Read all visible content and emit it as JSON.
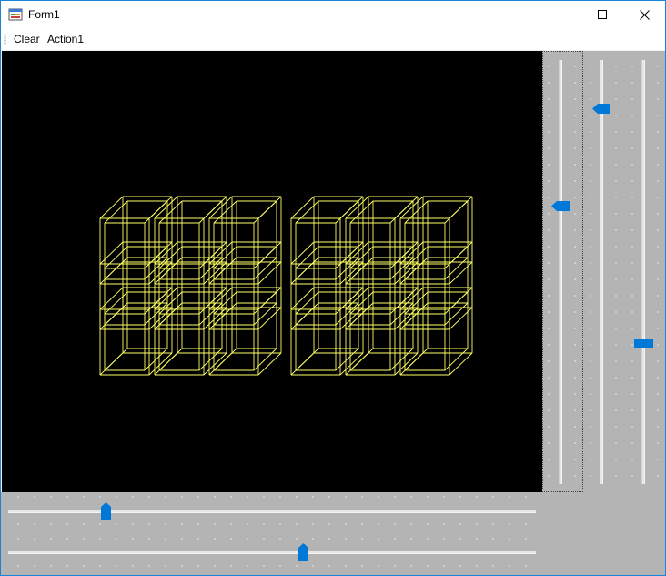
{
  "window": {
    "title": "Form1",
    "controls": [
      "minimize",
      "maximize",
      "close"
    ]
  },
  "menu": {
    "items": [
      {
        "label": "Clear"
      },
      {
        "label": "Action1"
      }
    ]
  },
  "viewport": {
    "background": "#000000",
    "wire_color": "#ffff66",
    "content": "two 3x3 grids of wireframe cubes"
  },
  "sliders": {
    "vertical_1": {
      "value": 0.34,
      "focused": true
    },
    "vertical_2": {
      "value": 0.11
    },
    "vertical_3": {
      "value": 0.66
    },
    "horizontal_1": {
      "value": 0.185
    },
    "horizontal_2": {
      "value": 0.56
    }
  },
  "colors": {
    "accent": "#0078d7",
    "panel": "#b4b4b4"
  }
}
